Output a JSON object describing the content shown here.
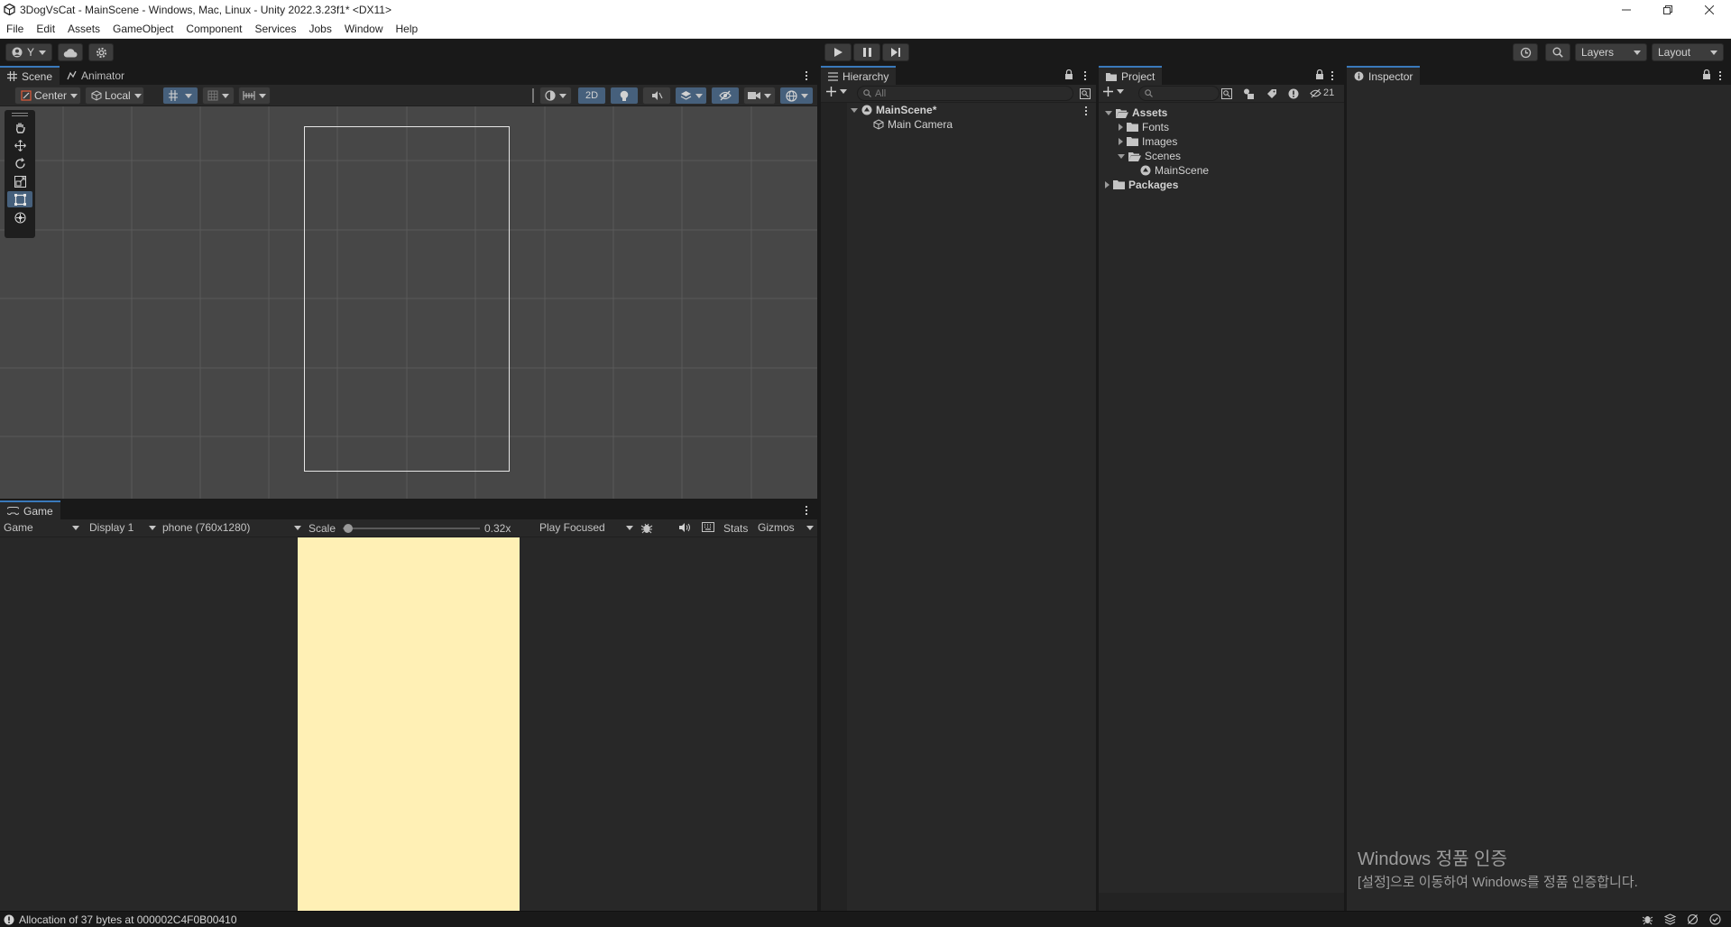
{
  "window": {
    "title": "3DogVsCat - MainScene - Windows, Mac, Linux - Unity 2022.3.23f1* <DX11>"
  },
  "menu": [
    "File",
    "Edit",
    "Assets",
    "GameObject",
    "Component",
    "Services",
    "Jobs",
    "Window",
    "Help"
  ],
  "toolbar": {
    "account_label": "Y",
    "layers_label": "Layers",
    "layout_label": "Layout"
  },
  "scene_panel": {
    "tabs": [
      "Scene",
      "Animator"
    ],
    "pivot_label": "Center",
    "space_label": "Local",
    "mode_2d_label": "2D"
  },
  "game_panel": {
    "tab": "Game",
    "view_label": "Game",
    "display_label": "Display 1",
    "resolution_label": "phone (760x1280)",
    "scale_label": "Scale",
    "scale_value": "0.32x",
    "play_mode_label": "Play Focused",
    "stats_label": "Stats",
    "gizmos_label": "Gizmos",
    "canvas_color": "#fff0b5"
  },
  "hierarchy": {
    "tab": "Hierarchy",
    "search_placeholder": "All",
    "scene_name": "MainScene*",
    "items": [
      "Main Camera"
    ]
  },
  "project": {
    "tab": "Project",
    "hidden_count": "21",
    "tree": {
      "assets": "Assets",
      "fonts": "Fonts",
      "images": "Images",
      "scenes": "Scenes",
      "main_scene": "MainScene",
      "packages": "Packages"
    }
  },
  "inspector": {
    "tab": "Inspector"
  },
  "watermark": {
    "line1": "Windows 정품 인증",
    "line2": "[설정]으로 이동하여 Windows를 정품 인증합니다."
  },
  "status": {
    "message": "Allocation of 37 bytes at 000002C4F0B00410"
  },
  "colors": {
    "accent": "#3a79bb",
    "panel": "#282828",
    "scene_bg": "#474747"
  }
}
